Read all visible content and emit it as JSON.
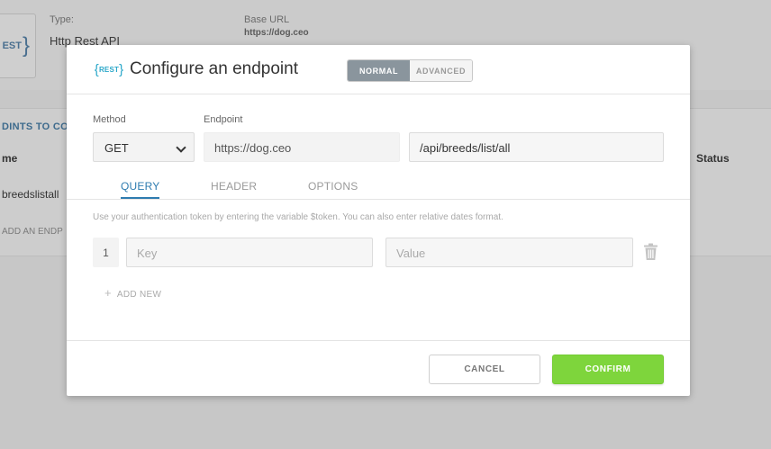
{
  "background": {
    "type_label": "Type:",
    "type_value": "Http Rest API",
    "base_url_label": "Base URL",
    "base_url_value": "https://dog.ceo",
    "logo_text": "EST",
    "section_title": "DINTS TO CONN",
    "col_name": "me",
    "col_status": "Status",
    "row_text": "breedslistall",
    "add_text": "ADD AN ENDP"
  },
  "modal": {
    "icon_text": "REST",
    "title": "Configure an endpoint",
    "mode_toggle": {
      "normal": "NORMAL",
      "advanced": "ADVANCED",
      "selected": "NORMAL"
    },
    "method": {
      "label": "Method",
      "value": "GET"
    },
    "endpoint": {
      "label": "Endpoint",
      "base": "https://dog.ceo",
      "path": "/api/breeds/list/all"
    },
    "tabs": [
      {
        "label": "QUERY",
        "active": true
      },
      {
        "label": "HEADER",
        "active": false
      },
      {
        "label": "OPTIONS",
        "active": false
      }
    ],
    "hint": "Use your authentication token by entering the variable $token. You can also enter relative dates format.",
    "query_rows": [
      {
        "index": "1",
        "key_placeholder": "Key",
        "value_placeholder": "Value"
      }
    ],
    "add_new_label": "ADD NEW",
    "buttons": {
      "cancel": "CANCEL",
      "confirm": "CONFIRM"
    }
  },
  "colors": {
    "accent_blue": "#2e7cb0",
    "rest_icon": "#2aa7c9",
    "confirm_green": "#7ed53c",
    "toggle_active": "#8a959d",
    "overlay": "#c7c7c7"
  }
}
